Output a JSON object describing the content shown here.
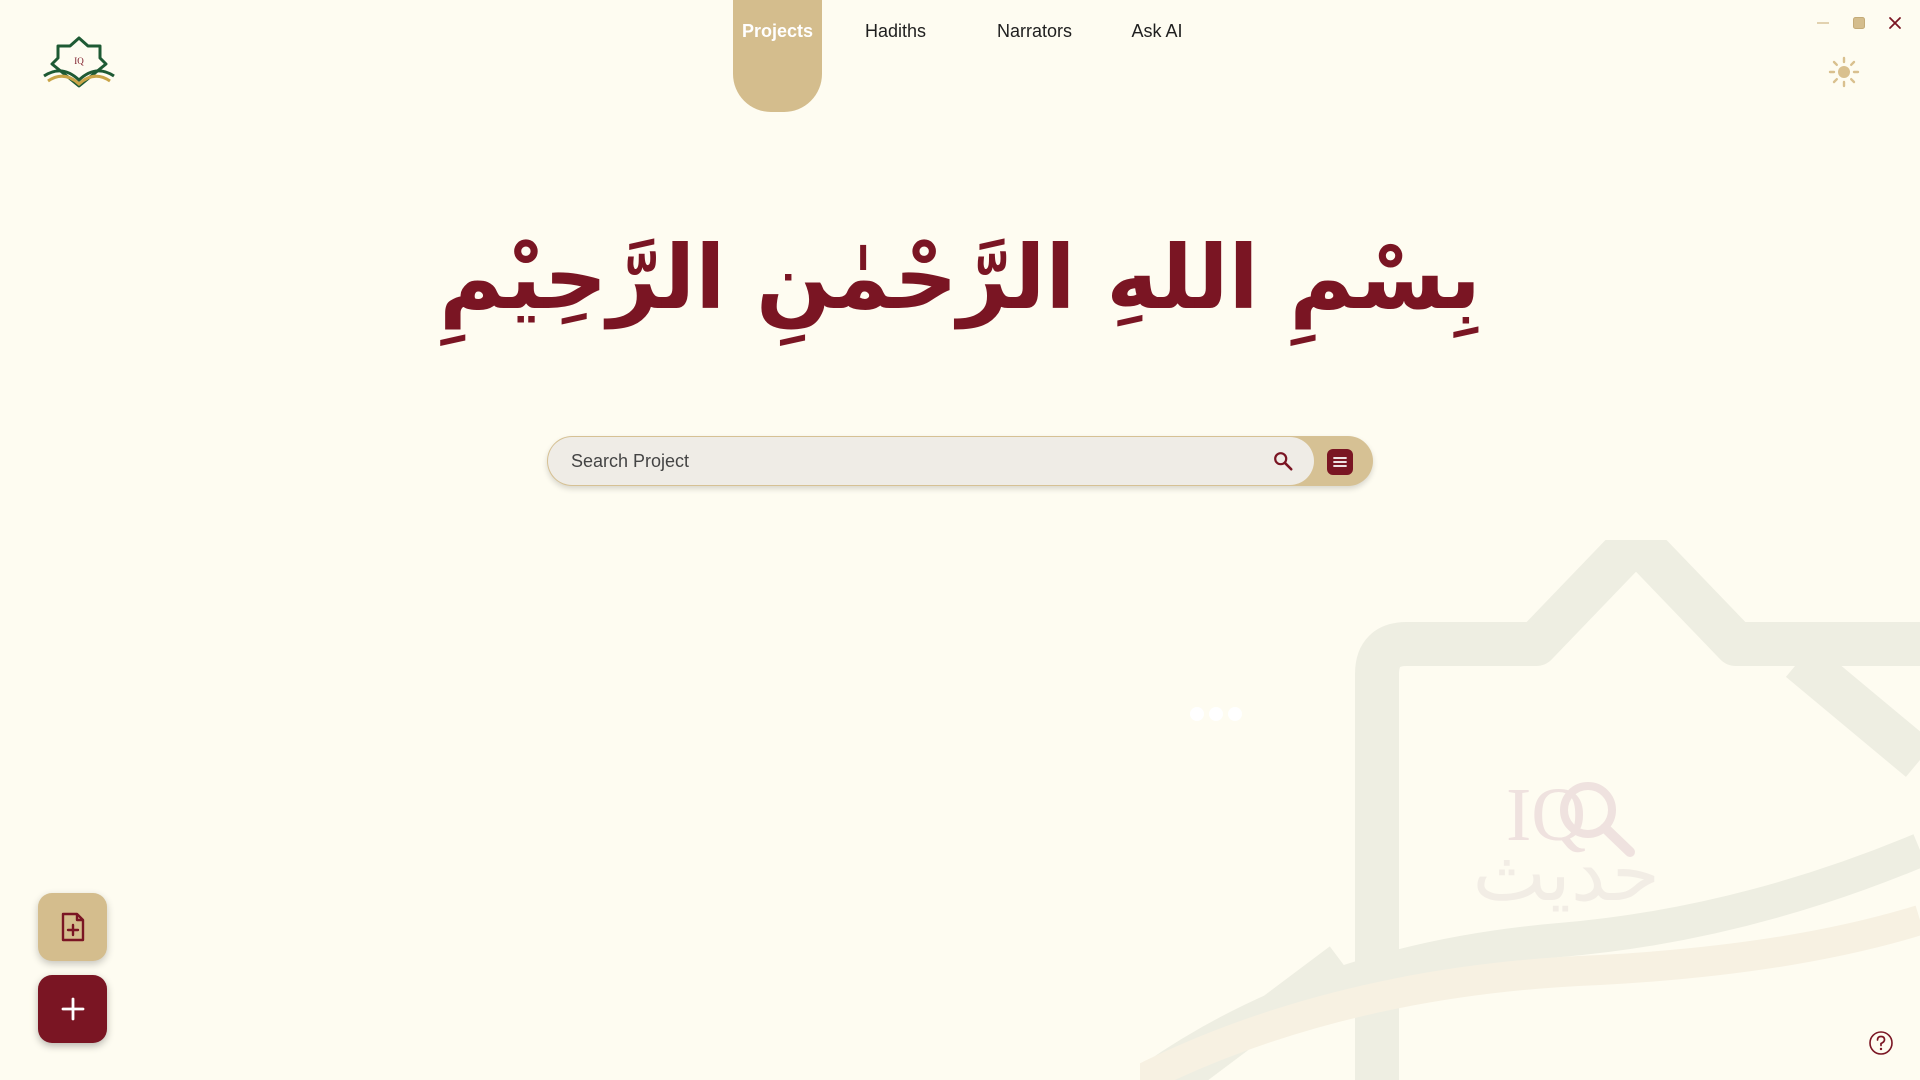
{
  "nav": {
    "tabs": [
      {
        "label": "Projects",
        "active": true
      },
      {
        "label": "Hadiths",
        "active": false
      },
      {
        "label": "Narrators",
        "active": false
      },
      {
        "label": "Ask AI",
        "active": false
      }
    ]
  },
  "hero": {
    "bismillah": "بِسْمِ اللهِ الرَّحْمٰنِ الرَّحِيْمِ"
  },
  "search": {
    "placeholder": "Search Project"
  },
  "watermark": {
    "logo_text": "IQ",
    "arabic_text": "حديث"
  },
  "colors": {
    "background": "#fefcf1",
    "accent_gold": "#d4bd8d",
    "brand_maroon": "#7a1523"
  },
  "icons": {
    "logo": "app-logo-icon",
    "minimize": "minimize-icon",
    "maximize": "maximize-icon",
    "close": "close-icon",
    "theme": "sun-icon",
    "search": "search-icon",
    "filter": "list-filter-icon",
    "new_file": "file-plus-icon",
    "add": "plus-icon",
    "help": "help-icon"
  }
}
